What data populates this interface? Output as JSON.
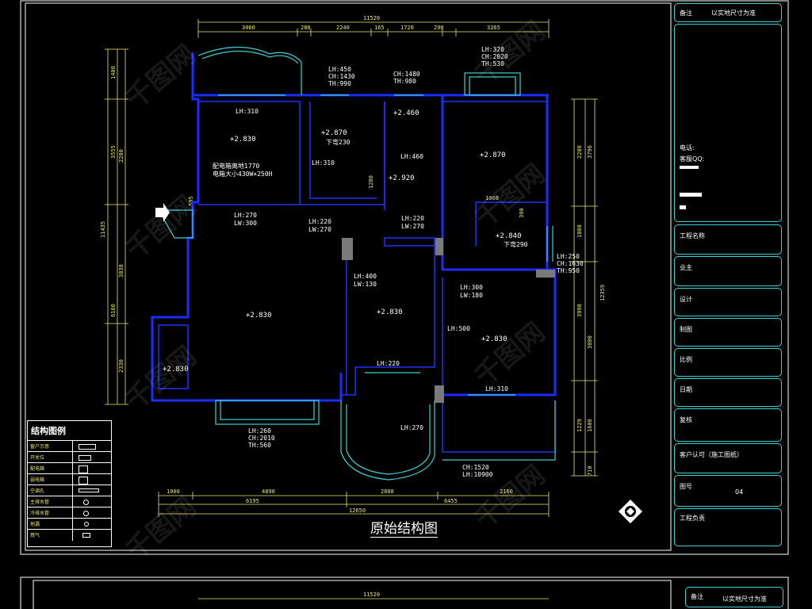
{
  "drawing": {
    "title": "原始结构图",
    "total_width_top": "11520",
    "top_segments": [
      "3060",
      "280",
      "2240",
      "165",
      "1720",
      "290",
      "3265"
    ],
    "bottom_segments": [
      "1000",
      "4890",
      "2888",
      "2160"
    ],
    "bottom_sub": [
      "6195",
      "6455"
    ],
    "total_width_bottom": "12650",
    "left_total": "11435",
    "left_segments": [
      "1400",
      "2280",
      "3838",
      "2330"
    ],
    "left_sub": [
      "3555",
      "6160"
    ],
    "left_small": "595",
    "right_segments": [
      "2280",
      "1088",
      "3998",
      "1229",
      "1608"
    ],
    "right_sub": [
      "3796",
      "3880",
      "1225"
    ],
    "right_total": "12359",
    "right_small": "710"
  },
  "annotations": [
    {
      "id": "a1",
      "text": "LH:450"
    },
    {
      "id": "a2",
      "text": "CH:1430"
    },
    {
      "id": "a3",
      "text": "TH:990"
    },
    {
      "id": "a4",
      "text": "CH:1480"
    },
    {
      "id": "a5",
      "text": "TH:980"
    },
    {
      "id": "a6",
      "text": "LH:320"
    },
    {
      "id": "a7",
      "text": "CH:2020"
    },
    {
      "id": "a8",
      "text": "TH:530"
    },
    {
      "id": "a9",
      "text": "LH:310"
    },
    {
      "id": "a10",
      "text": "+2.830"
    },
    {
      "id": "a11",
      "text": "+2.870"
    },
    {
      "id": "a12",
      "text": "下弯230"
    },
    {
      "id": "a13",
      "text": "+2.460"
    },
    {
      "id": "a14",
      "text": "+2.870"
    },
    {
      "id": "a15",
      "text": "LH:310"
    },
    {
      "id": "a16",
      "text": "LH:460"
    },
    {
      "id": "a17",
      "text": "+2.920"
    },
    {
      "id": "a18",
      "text": "1280"
    },
    {
      "id": "a19",
      "text": "配电箱离地1770"
    },
    {
      "id": "a20",
      "text": "电箱大小430W×250H"
    },
    {
      "id": "a21",
      "text": "LH:270"
    },
    {
      "id": "a22",
      "text": "LW:300"
    },
    {
      "id": "a23",
      "text": "LH:220"
    },
    {
      "id": "a24",
      "text": "LW:270"
    },
    {
      "id": "a25",
      "text": "LH:220"
    },
    {
      "id": "a26",
      "text": "LW:270"
    },
    {
      "id": "a27",
      "text": "1060"
    },
    {
      "id": "a28",
      "text": "390"
    },
    {
      "id": "a29",
      "text": "+2.840"
    },
    {
      "id": "a30",
      "text": "下弯290"
    },
    {
      "id": "a31",
      "text": "LH:250"
    },
    {
      "id": "a32",
      "text": "CH:1630"
    },
    {
      "id": "a33",
      "text": "TH:950"
    },
    {
      "id": "a34",
      "text": "LH:400"
    },
    {
      "id": "a35",
      "text": "LW:130"
    },
    {
      "id": "a36",
      "text": "LH:300"
    },
    {
      "id": "a37",
      "text": "LW:180"
    },
    {
      "id": "a38",
      "text": "+2.830"
    },
    {
      "id": "a39",
      "text": "+2.830"
    },
    {
      "id": "a40",
      "text": "LH:500"
    },
    {
      "id": "a41",
      "text": "+2.830"
    },
    {
      "id": "a42",
      "text": "+2.830"
    },
    {
      "id": "a43",
      "text": "LH:220"
    },
    {
      "id": "a44",
      "text": "LH:310"
    },
    {
      "id": "a45",
      "text": "LH:260"
    },
    {
      "id": "a46",
      "text": "CH:2010"
    },
    {
      "id": "a47",
      "text": "TH:560"
    },
    {
      "id": "a48",
      "text": "LH:270"
    },
    {
      "id": "a49",
      "text": "CH:1520"
    },
    {
      "id": "a50",
      "text": "LH:10900"
    },
    {
      "id": "a51",
      "text": "595"
    }
  ],
  "legend": {
    "title": "结构图例",
    "rows": [
      "窗户示意",
      "开关位",
      "配电箱",
      "弱电箱",
      "空调孔",
      "主排水管",
      "冷排水管",
      "地漏",
      "燃气"
    ]
  },
  "title_block": {
    "note_label": "备注",
    "note_value": "以实地尺寸为准",
    "phone_label": "电话:",
    "phone_value": "客服QQ:",
    "project_name": "工程名称",
    "owner": "业主",
    "design": "设计",
    "drafting": "制图",
    "scale": "比例",
    "date": "日期",
    "review": "复核",
    "client_approval": "客户认可（施工图纸）",
    "drawing_no_label": "图号",
    "drawing_no_value": "04",
    "project_lead": "工程负责"
  },
  "lower_sheet": {
    "note_label": "备注",
    "note_value": "以实地尺寸为准",
    "total_width": "11520"
  },
  "colors": {
    "background": "#000000",
    "walls": "#1a2dff",
    "windows": "#3fd0d0",
    "dimensions": "#e8e86a",
    "text": "#ffffff"
  },
  "watermark": "千图网"
}
